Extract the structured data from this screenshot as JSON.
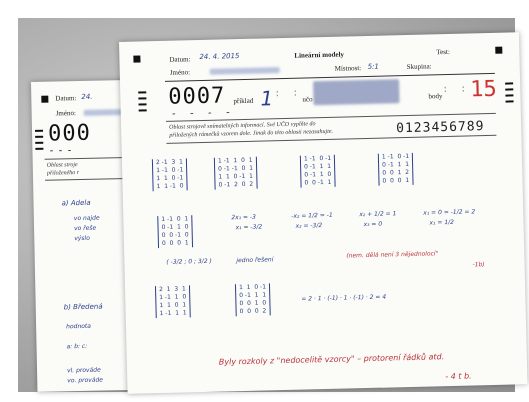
{
  "form": {
    "datum_label": "Datum:",
    "datum_value": "24. 4. 2015",
    "title": "Lineární modely",
    "test_label": "Test:",
    "jmeno_label": "Jméno:",
    "mistnost_label": "Místnost:",
    "mistnost_value": "5:1",
    "skupina_label": "Skupina:",
    "code": "0007",
    "priklad_label": "příklad",
    "uco_label": "učo",
    "body_label": "body",
    "body_value": "15",
    "notice_line1": "Oblast strojově snímatelných informací. Své UČO vyplňte do",
    "notice_line2": "přiložených rámečků vzorem dole. Jinak do této oblasti nezasahujte.",
    "digit_sample": "0123456789"
  },
  "back_sheet": {
    "datum_label": "Datum:",
    "datum_value": "24.",
    "jmeno_label": "Jméno:",
    "code": "000",
    "notice_line1": "Oblast stroje",
    "notice_line2": "přiloženého r",
    "notes": [
      "a) Adela",
      "vo najde",
      "vo řeše",
      "výslo",
      "b) Bředená",
      "hodnota",
      "a: b: c:",
      "vl. prováde",
      "vo. prováde"
    ]
  },
  "handwriting": {
    "eq1": "2x₁ = -3",
    "eq1b": "x₁ = -3/2",
    "eq2": "-x₂ = 1/2 = -1",
    "eq2b": "x₂ = -3/2",
    "eq3": "x₂ + 1/2 = 1",
    "eq3b": "x₃ = 0",
    "eq4": "x₁ = 0 = -1/2 = 2",
    "eq4b": "x₁ = 1/2",
    "solution_vector": "( -3/2 ; 0 ; 3/2 )",
    "solution_text": "jedno řešení",
    "red_note1": "(nem. dělá není 3 nějednolocí\"",
    "red_note2": "-1b)",
    "det_text": "= 2 · 1 · (-1) · 1 · (-1) · 2 = 4",
    "red_note3": "Byly rozkoly z \"nedocelitě vzorcy\" – protorení řádků atd.",
    "red_note4": "- 4 t b."
  }
}
